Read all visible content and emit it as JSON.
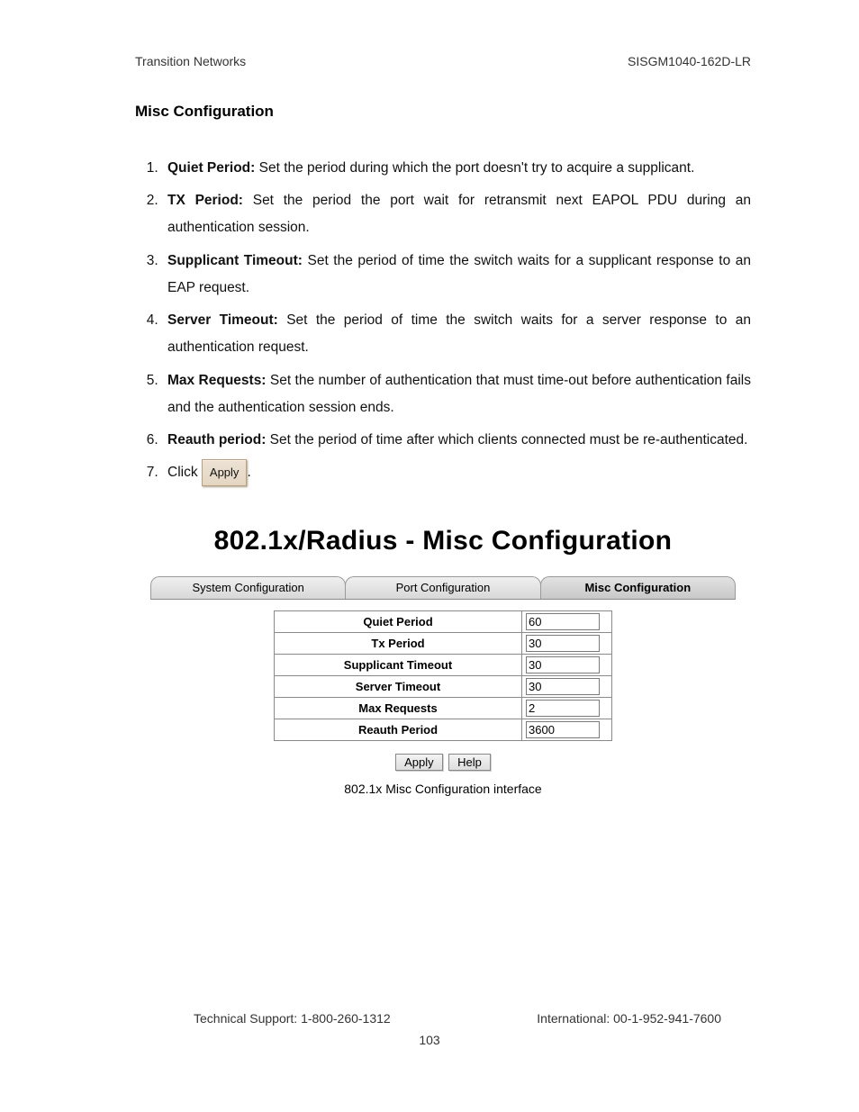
{
  "header": {
    "left": "Transition Networks",
    "right": "SISGM1040-162D-LR"
  },
  "section_title": "Misc Configuration",
  "items": [
    {
      "term": "Quiet Period:",
      "desc": " Set the period during which the port doesn't try to acquire a supplicant."
    },
    {
      "term": "TX Period:",
      "desc": " Set the period the port wait for retransmit next EAPOL PDU during an authentication session."
    },
    {
      "term": "Supplicant Timeout:",
      "desc": " Set the period of time the switch waits for a supplicant response to an EAP request."
    },
    {
      "term": "Server Timeout:",
      "desc": " Set the period of time the switch waits for a server response to an authentication request."
    },
    {
      "term": "Max Requests:",
      "desc": " Set the number of authentication that must time-out before authentication fails and the authentication session ends."
    },
    {
      "term": "Reauth period:",
      "desc": " Set the period of time after which clients connected must be re-authenticated."
    }
  ],
  "click_label": "Click",
  "inline_apply_label": "Apply",
  "period_after_apply": ".",
  "panel": {
    "title": "802.1x/Radius - Misc Configuration",
    "tabs": [
      "System Configuration",
      "Port Configuration",
      "Misc Configuration"
    ],
    "active_tab_index": 2,
    "rows": [
      {
        "label": "Quiet Period",
        "value": "60"
      },
      {
        "label": "Tx Period",
        "value": "30"
      },
      {
        "label": "Supplicant Timeout",
        "value": "30"
      },
      {
        "label": "Server Timeout",
        "value": "30"
      },
      {
        "label": "Max Requests",
        "value": "2"
      },
      {
        "label": "Reauth Period",
        "value": "3600"
      }
    ],
    "buttons": {
      "apply": "Apply",
      "help": "Help"
    },
    "caption": "802.1x Misc Configuration interface"
  },
  "footer": {
    "tech_support": "Technical Support: 1-800-260-1312",
    "international": "International: 00-1-952-941-7600",
    "page_number": "103"
  }
}
